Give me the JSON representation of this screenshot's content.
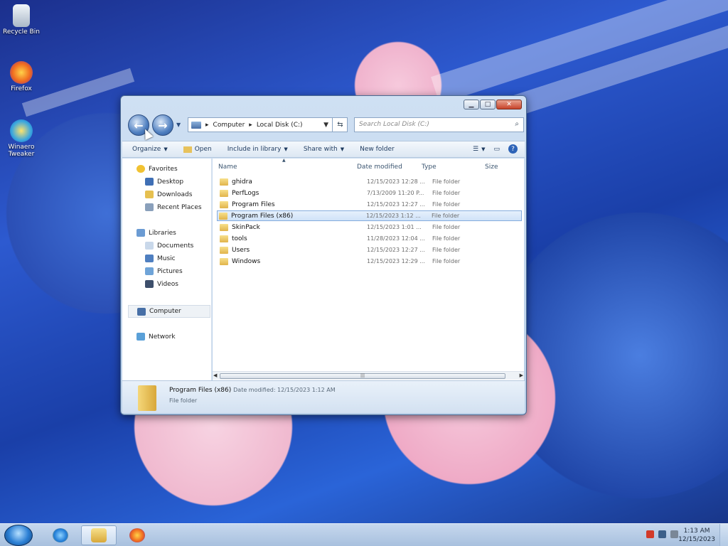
{
  "desktop": {
    "icons": [
      {
        "label": "Recycle Bin",
        "icon": "recycle-bin-icon"
      },
      {
        "label": "Firefox",
        "icon": "firefox-icon"
      },
      {
        "label": "Winaero Tweaker",
        "icon": "winaero-tweaker-icon"
      }
    ]
  },
  "window": {
    "address": {
      "part1": "Computer",
      "part2": "Local Disk (C:)"
    },
    "search_placeholder": "Search Local Disk (C:)",
    "toolbar": {
      "organize": "Organize",
      "open": "Open",
      "include_in_library": "Include in library",
      "share_with": "Share with",
      "new_folder": "New folder"
    },
    "nav": {
      "favorites": "Favorites",
      "desktop": "Desktop",
      "downloads": "Downloads",
      "recent_places": "Recent Places",
      "libraries": "Libraries",
      "documents": "Documents",
      "music": "Music",
      "pictures": "Pictures",
      "videos": "Videos",
      "computer": "Computer",
      "network": "Network"
    },
    "columns": {
      "name": "Name",
      "date": "Date modified",
      "type": "Type",
      "size": "Size"
    },
    "files": [
      {
        "name": "ghidra",
        "date": "12/15/2023 12:28 ...",
        "type": "File folder"
      },
      {
        "name": "PerfLogs",
        "date": "7/13/2009 11:20 P...",
        "type": "File folder"
      },
      {
        "name": "Program Files",
        "date": "12/15/2023 12:27 ...",
        "type": "File folder"
      },
      {
        "name": "Program Files (x86)",
        "date": "12/15/2023 1:12 ...",
        "type": "File folder",
        "selected": true
      },
      {
        "name": "SkinPack",
        "date": "12/15/2023 1:01 ...",
        "type": "File folder"
      },
      {
        "name": "tools",
        "date": "11/28/2023 12:04 ...",
        "type": "File folder"
      },
      {
        "name": "Users",
        "date": "12/15/2023 12:27 ...",
        "type": "File folder"
      },
      {
        "name": "Windows",
        "date": "12/15/2023 12:29 ...",
        "type": "File folder"
      }
    ],
    "details": {
      "name": "Program Files (x86)",
      "modified": "Date modified: 12/15/2023 1:12 AM",
      "type": "File folder"
    }
  },
  "taskbar": {
    "time": "1:13 AM",
    "date": "12/15/2023"
  }
}
